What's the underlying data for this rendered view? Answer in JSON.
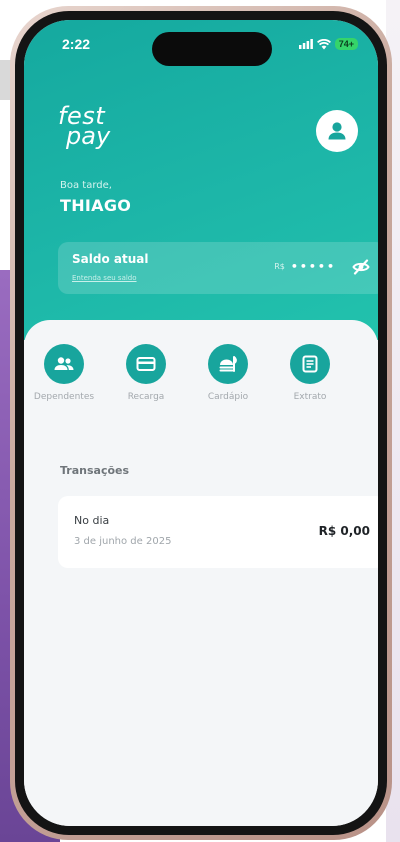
{
  "status_bar": {
    "time": "2:22",
    "battery": "74+"
  },
  "header": {
    "logo_line1": "fest",
    "logo_line2": "pay",
    "greeting": "Boa tarde,",
    "username": "THIAGO"
  },
  "balance": {
    "label": "Saldo atual",
    "link": "Entenda seu saldo",
    "currency": "R$",
    "masked": "•••••"
  },
  "actions": [
    {
      "label": "Dependentes",
      "icon": "people-icon"
    },
    {
      "label": "Recarga",
      "icon": "card-icon"
    },
    {
      "label": "Cardápio",
      "icon": "menu-food-icon"
    },
    {
      "label": "Extrato",
      "icon": "statement-icon"
    }
  ],
  "transactions": {
    "title": "Transações",
    "items": [
      {
        "title": "No dia",
        "date": "3 de junho de 2025",
        "amount": "R$ 0,00"
      }
    ]
  },
  "colors": {
    "primary": "#18a59d",
    "header_gradient_start": "#15a99f",
    "header_gradient_end": "#22c2ad",
    "background": "#f4f6f8",
    "battery": "#35d46a"
  }
}
